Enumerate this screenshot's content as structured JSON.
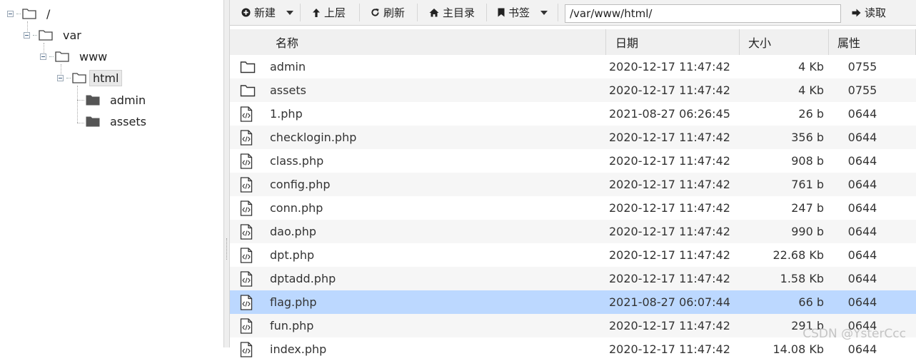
{
  "tree": {
    "root": "/",
    "var": "var",
    "www": "www",
    "html": "html",
    "admin": "admin",
    "assets": "assets"
  },
  "toolbar": {
    "new": "新建",
    "up": "上层",
    "refresh": "刷新",
    "home": "主目录",
    "bookmark": "书签",
    "path": "/var/www/html/",
    "read": "读取"
  },
  "columns": {
    "name": "名称",
    "date": "日期",
    "size": "大小",
    "perm": "属性"
  },
  "files": [
    {
      "name": "admin",
      "date": "2020-12-17 11:47:42",
      "size": "4 Kb",
      "perm": "0755",
      "kind": "folder"
    },
    {
      "name": "assets",
      "date": "2020-12-17 11:47:42",
      "size": "4 Kb",
      "perm": "0755",
      "kind": "folder"
    },
    {
      "name": "1.php",
      "date": "2021-08-27 06:26:45",
      "size": "26 b",
      "perm": "0644",
      "kind": "code"
    },
    {
      "name": "checklogin.php",
      "date": "2020-12-17 11:47:42",
      "size": "356 b",
      "perm": "0644",
      "kind": "code"
    },
    {
      "name": "class.php",
      "date": "2020-12-17 11:47:42",
      "size": "908 b",
      "perm": "0644",
      "kind": "code"
    },
    {
      "name": "config.php",
      "date": "2020-12-17 11:47:42",
      "size": "761 b",
      "perm": "0644",
      "kind": "code"
    },
    {
      "name": "conn.php",
      "date": "2020-12-17 11:47:42",
      "size": "247 b",
      "perm": "0644",
      "kind": "code"
    },
    {
      "name": "dao.php",
      "date": "2020-12-17 11:47:42",
      "size": "990 b",
      "perm": "0644",
      "kind": "code"
    },
    {
      "name": "dpt.php",
      "date": "2020-12-17 11:47:42",
      "size": "22.68 Kb",
      "perm": "0644",
      "kind": "code"
    },
    {
      "name": "dptadd.php",
      "date": "2020-12-17 11:47:42",
      "size": "1.58 Kb",
      "perm": "0644",
      "kind": "code"
    },
    {
      "name": "flag.php",
      "date": "2021-08-27 06:07:44",
      "size": "66 b",
      "perm": "0644",
      "kind": "code",
      "selected": true
    },
    {
      "name": "fun.php",
      "date": "2020-12-17 11:47:42",
      "size": "291 b",
      "perm": "0644",
      "kind": "code"
    },
    {
      "name": "index.php",
      "date": "2020-12-17 11:47:42",
      "size": "14.08 Kb",
      "perm": "0644",
      "kind": "code"
    }
  ],
  "watermark": "CSDN @YsterCcc",
  "colors": {
    "selected_row": "#bcd8ff",
    "toolbar_bg": "#f2f2f2",
    "header_bg": "#f0f0f0"
  }
}
